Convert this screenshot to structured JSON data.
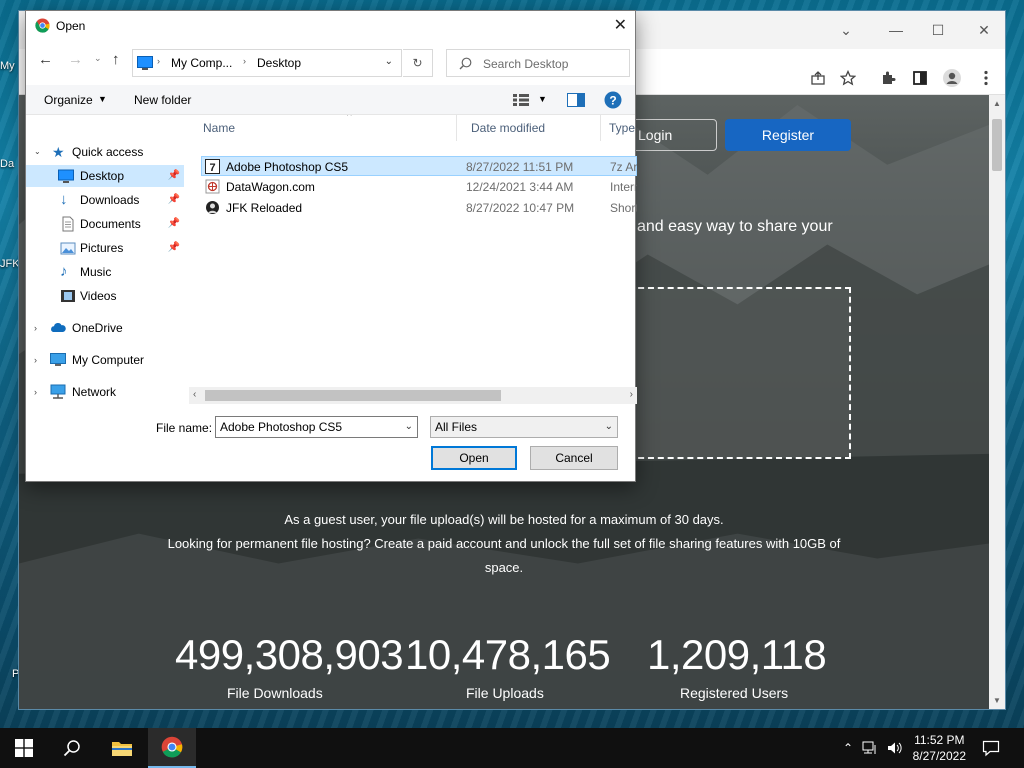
{
  "desktop": {
    "icons": [
      "My",
      "Da",
      "JFK",
      "P"
    ]
  },
  "browser": {
    "header": {
      "login_label": "Login",
      "register_label": "Register"
    },
    "tagline": "and easy way to share your",
    "notice_line1": "As a guest user, your file upload(s) will be hosted for a maximum of 30 days.",
    "notice_line2": "Looking for permanent file hosting? Create a paid account and unlock the full set of file sharing features with 10GB of",
    "notice_line3": "space.",
    "stats": [
      {
        "value": "499,308,903",
        "label": "File Downloads"
      },
      {
        "value": "10,478,165",
        "label": "File Uploads"
      },
      {
        "value": "1,209,118",
        "label": "Registered Users"
      }
    ]
  },
  "dialog": {
    "title": "Open",
    "address": {
      "segments": [
        "My Comp...",
        "Desktop"
      ]
    },
    "search_placeholder": "Search Desktop",
    "commands": {
      "organize": "Organize",
      "new_folder": "New folder"
    },
    "nav": {
      "quick_access": "Quick access",
      "items": [
        "Desktop",
        "Downloads",
        "Documents",
        "Pictures",
        "Music",
        "Videos"
      ],
      "onedrive": "OneDrive",
      "my_computer": "My Computer",
      "network": "Network"
    },
    "columns": {
      "name": "Name",
      "date": "Date modified",
      "type": "Type"
    },
    "files": [
      {
        "name": "Adobe Photoshop CS5",
        "date": "8/27/2022 11:51 PM",
        "type": "7z Ar"
      },
      {
        "name": "DataWagon.com",
        "date": "12/24/2021 3:44 AM",
        "type": "Intern"
      },
      {
        "name": "JFK Reloaded",
        "date": "8/27/2022 10:47 PM",
        "type": "Shortc"
      }
    ],
    "file_name_label": "File name:",
    "file_name_value": "Adobe Photoshop CS5",
    "filter_value": "All Files",
    "open_label": "Open",
    "cancel_label": "Cancel"
  },
  "taskbar": {
    "time": "11:52 PM",
    "date": "8/27/2022"
  },
  "colors": {
    "accent": "#0078d7",
    "register": "#1766c2",
    "selection": "#cce8ff"
  }
}
